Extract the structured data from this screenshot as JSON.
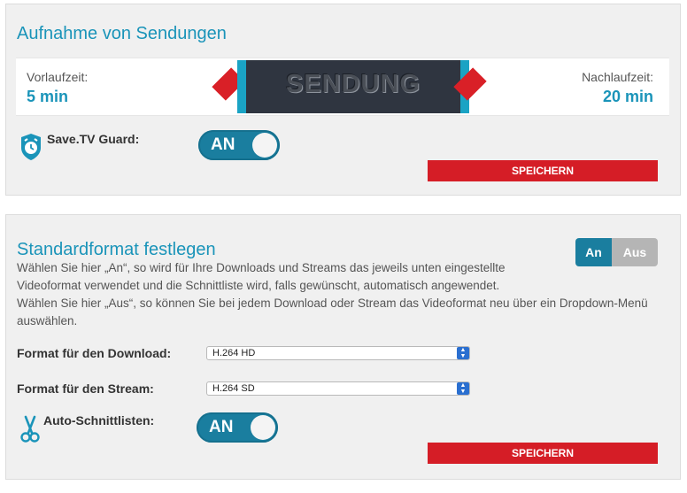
{
  "recording": {
    "title": "Aufnahme von Sendungen",
    "lead_label": "Vorlaufzeit:",
    "lead_value": "5 min",
    "trail_label": "Nachlaufzeit:",
    "trail_value": "20 min",
    "program_label": "SENDUNG",
    "guard_label": "Save.TV Guard:",
    "guard_state": "AN",
    "save_label": "SPEICHERN"
  },
  "format": {
    "title": "Standardformat festlegen",
    "toggle_on": "An",
    "toggle_off": "Aus",
    "description_line1": "Wählen Sie hier „An“, so wird für Ihre Downloads und Streams das jeweils unten eingestellte",
    "description_line2": "Videoformat verwendet und die Schnittliste wird, falls gewünscht, automatisch angewendet.",
    "description_line3": "Wählen Sie hier „Aus“, so können Sie bei jedem Download oder Stream das Videoformat neu über ein Dropdown-Menü",
    "description_line4": "auswählen.",
    "download_label": "Format für den Download:",
    "download_value": "H.264 HD",
    "stream_label": "Format für den Stream:",
    "stream_value": "H.264 SD",
    "autocut_label": "Auto-Schnittlisten:",
    "autocut_state": "AN",
    "save_label": "SPEICHERN"
  },
  "colors": {
    "accent": "#1a94b9",
    "toggle": "#1a7e9f",
    "save": "#d51d26",
    "off_gray": "#b5b5b5"
  },
  "icons": {
    "guard": "alarm-shield-icon",
    "autocut": "scissors-icon"
  }
}
